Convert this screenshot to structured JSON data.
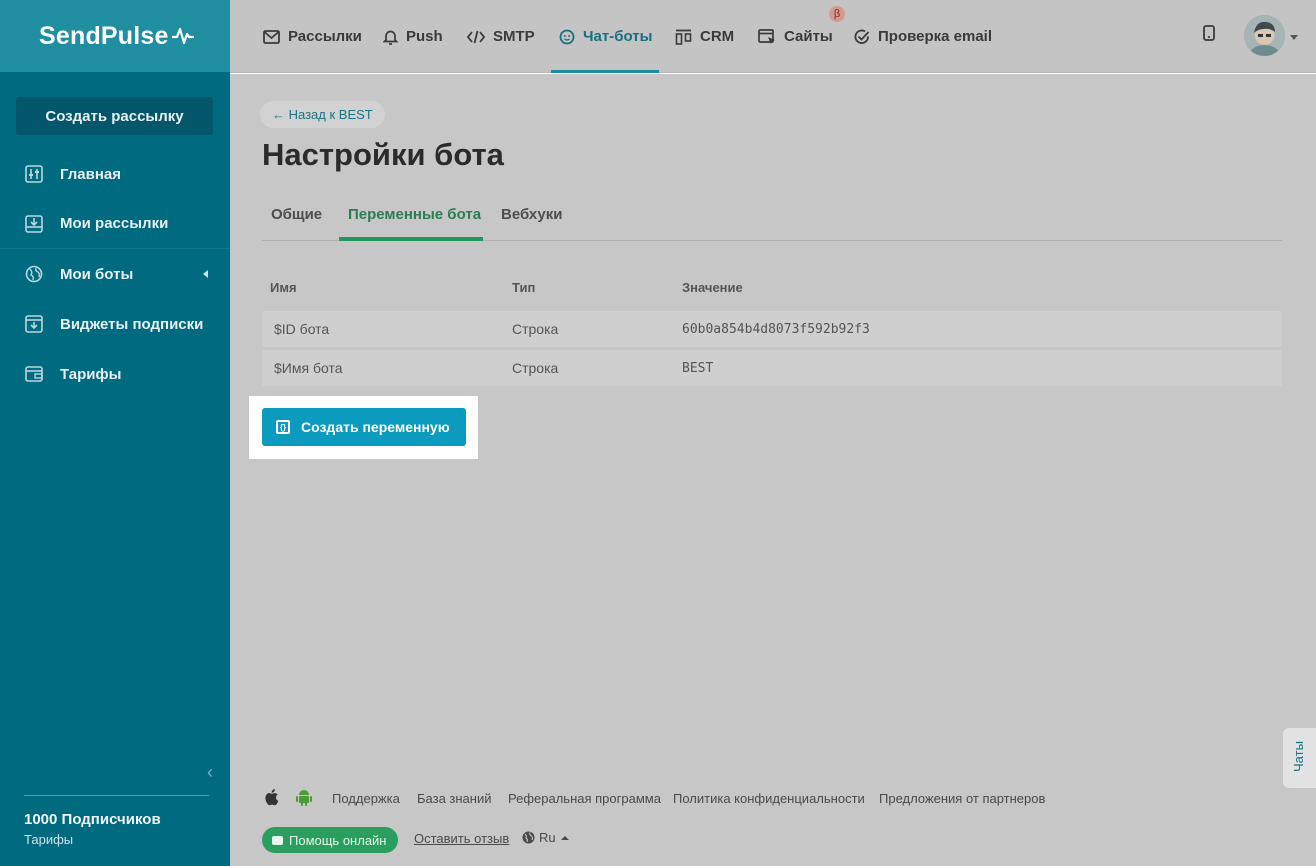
{
  "brand": {
    "logo_text": "SendPulse"
  },
  "sidebar": {
    "create_button": "Создать рассылку",
    "items": [
      {
        "label": "Главная",
        "icon": "sliders-icon"
      },
      {
        "label": "Мои рассылки",
        "icon": "inbox-icon"
      },
      {
        "label": "Мои боты",
        "icon": "globe-icon"
      },
      {
        "label": "Виджеты подписки",
        "icon": "download-box-icon"
      },
      {
        "label": "Тарифы",
        "icon": "wallet-icon"
      }
    ],
    "subscribers": "1000 Подписчиков",
    "plans_link": "Тарифы"
  },
  "topnav": {
    "items": [
      {
        "label": "Рассылки",
        "icon": "envelope-icon"
      },
      {
        "label": "Push",
        "icon": "bell-icon"
      },
      {
        "label": "SMTP",
        "icon": "code-icon"
      },
      {
        "label": "Чат-боты",
        "icon": "chat-bot-icon",
        "active": true
      },
      {
        "label": "CRM",
        "icon": "crm-icon"
      },
      {
        "label": "Сайты",
        "icon": "site-icon"
      },
      {
        "label": "Проверка email",
        "icon": "check-circle-icon"
      }
    ],
    "beta_badge": "β"
  },
  "page": {
    "back_link": "← Назад к BEST",
    "title": "Настройки бота",
    "tabs": [
      "Общие",
      "Переменные бота",
      "Вебхуки"
    ],
    "active_tab": "Переменные бота"
  },
  "table": {
    "headers": [
      "Имя",
      "Тип",
      "Значение"
    ],
    "rows": [
      {
        "name": "$ID бота",
        "type": "Строка",
        "value": "60b0a854b4d8073f592b92f3"
      },
      {
        "name": "$Имя бота",
        "type": "Строка",
        "value": "BEST"
      }
    ]
  },
  "create_variable_button": "Создать переменную",
  "chats_tab": "Чаты",
  "footer": {
    "links": [
      "Поддержка",
      "База знаний",
      "Реферальная программа",
      "Политика конфиденциальности",
      "Предложения от партнеров"
    ],
    "help_button": "Помощь онлайн",
    "review_link": "Оставить отзыв",
    "language": "Ru"
  },
  "colors": {
    "sidebar": "#006a80",
    "logo_bar": "#1f8ea1",
    "accent_blue": "#0a9bbf",
    "accent_green": "#24955b",
    "overlay_gray": "#c7c7c7"
  }
}
